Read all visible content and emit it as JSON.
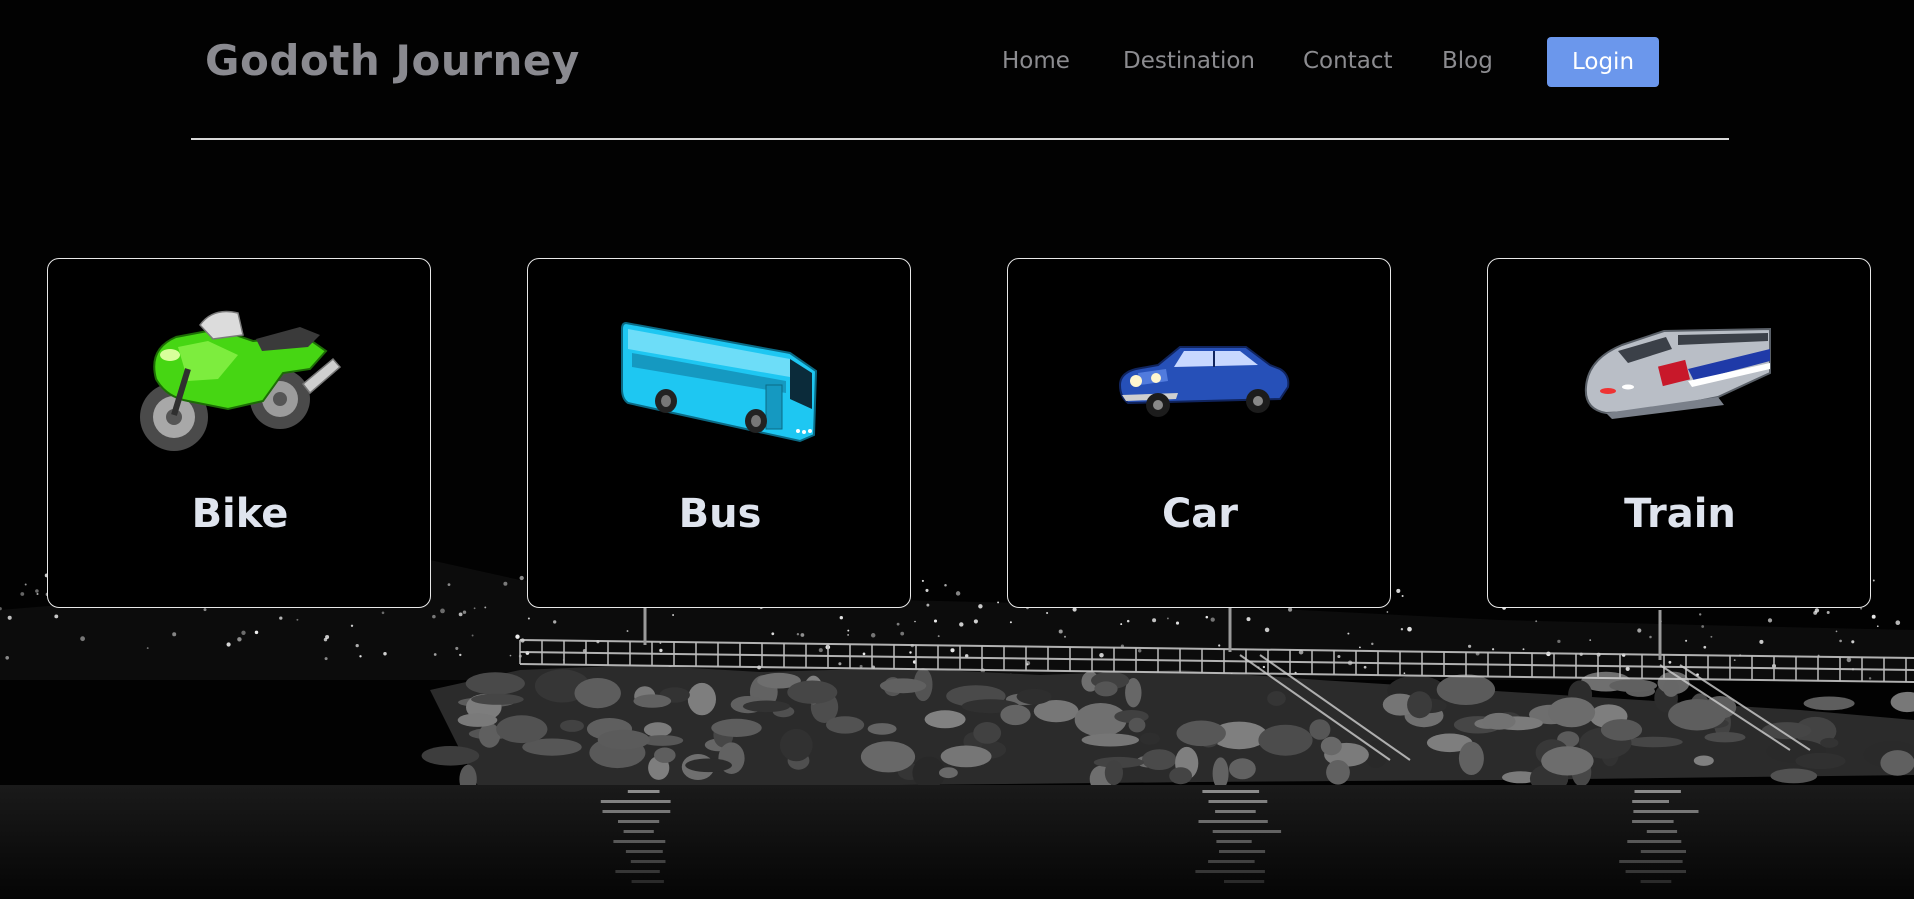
{
  "header": {
    "brand": "Godoth Journey",
    "nav": [
      {
        "label": "Home"
      },
      {
        "label": "Destination"
      },
      {
        "label": "Contact"
      },
      {
        "label": "Blog"
      }
    ],
    "login_label": "Login"
  },
  "cards": [
    {
      "label": "Bike",
      "icon": "motorcycle-icon"
    },
    {
      "label": "Bus",
      "icon": "bus-icon"
    },
    {
      "label": "Car",
      "icon": "car-icon"
    },
    {
      "label": "Train",
      "icon": "train-icon"
    }
  ],
  "colors": {
    "background": "#000000",
    "brand_text": "#8a8a90",
    "nav_text": "#8c8c90",
    "login_button": "#6b97ec",
    "card_border": "#e8e8e8",
    "card_label": "#dfe4ee"
  }
}
